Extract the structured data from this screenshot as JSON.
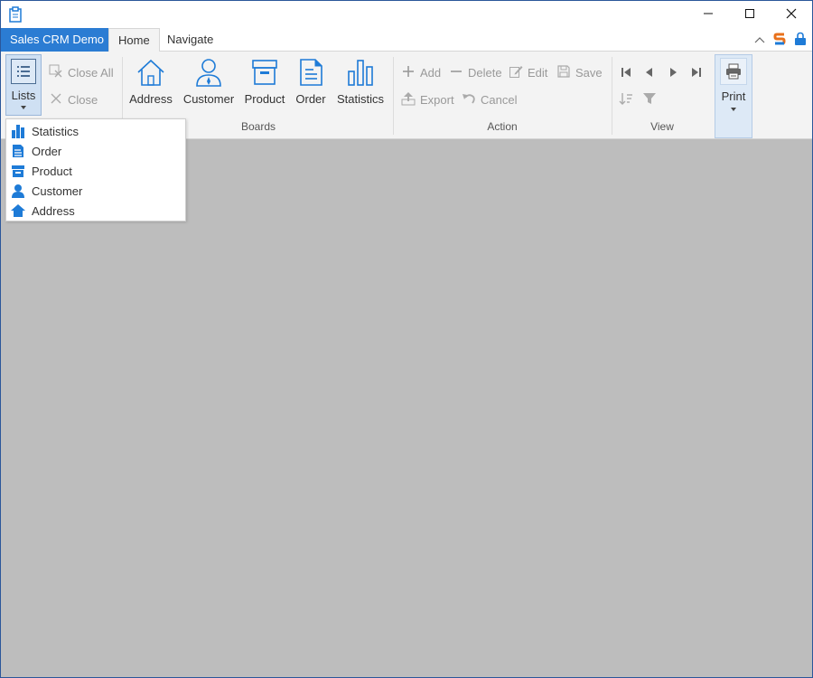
{
  "window": {
    "app_icon": "clipboard-icon",
    "minimize_icon": "minimize-icon",
    "maximize_icon": "maximize-icon",
    "close_icon": "close-icon"
  },
  "tabs": {
    "app_tab": "Sales CRM Demo",
    "items": [
      {
        "label": "Home",
        "active": true
      },
      {
        "label": "Navigate",
        "active": false
      }
    ],
    "right_icons": [
      "collapse-ribbon-icon",
      "brand-logo-icon",
      "lock-icon"
    ]
  },
  "ribbon": {
    "lists": {
      "label": "Lists",
      "icon": "list-icon"
    },
    "close_all": {
      "label": "Close All",
      "icon": "close-all-icon"
    },
    "close": {
      "label": "Close",
      "icon": "close-x-icon"
    },
    "boards": {
      "group_label": "Boards",
      "buttons": [
        {
          "label": "Address",
          "icon": "house-icon"
        },
        {
          "label": "Customer",
          "icon": "user-icon"
        },
        {
          "label": "Product",
          "icon": "box-icon"
        },
        {
          "label": "Order",
          "icon": "document-icon"
        },
        {
          "label": "Statistics",
          "icon": "bar-chart-icon"
        }
      ]
    },
    "action": {
      "group_label": "Action",
      "buttons": [
        {
          "label": "Add",
          "icon": "plus-icon"
        },
        {
          "label": "Delete",
          "icon": "minus-icon"
        },
        {
          "label": "Edit",
          "icon": "pencil-icon"
        },
        {
          "label": "Save",
          "icon": "floppy-icon"
        },
        {
          "label": "Export",
          "icon": "export-icon"
        },
        {
          "label": "Cancel",
          "icon": "undo-icon"
        }
      ]
    },
    "view": {
      "group_label": "View",
      "icons": [
        "first-record-icon",
        "previous-record-icon",
        "next-record-icon",
        "last-record-icon",
        "sort-icon",
        "filter-icon"
      ]
    },
    "print": {
      "label": "Print",
      "icon": "printer-icon"
    }
  },
  "lists_dropdown": {
    "items": [
      {
        "label": "Statistics",
        "icon": "bar-chart-icon"
      },
      {
        "label": "Order",
        "icon": "document-icon"
      },
      {
        "label": "Product",
        "icon": "box-icon"
      },
      {
        "label": "Customer",
        "icon": "user-icon"
      },
      {
        "label": "Address",
        "icon": "house-icon"
      }
    ]
  },
  "colors": {
    "accent": "#2b7cd3",
    "icon_blue": "#1e7bd7",
    "disabled_text": "#999999",
    "workspace": "#bdbdbd"
  }
}
